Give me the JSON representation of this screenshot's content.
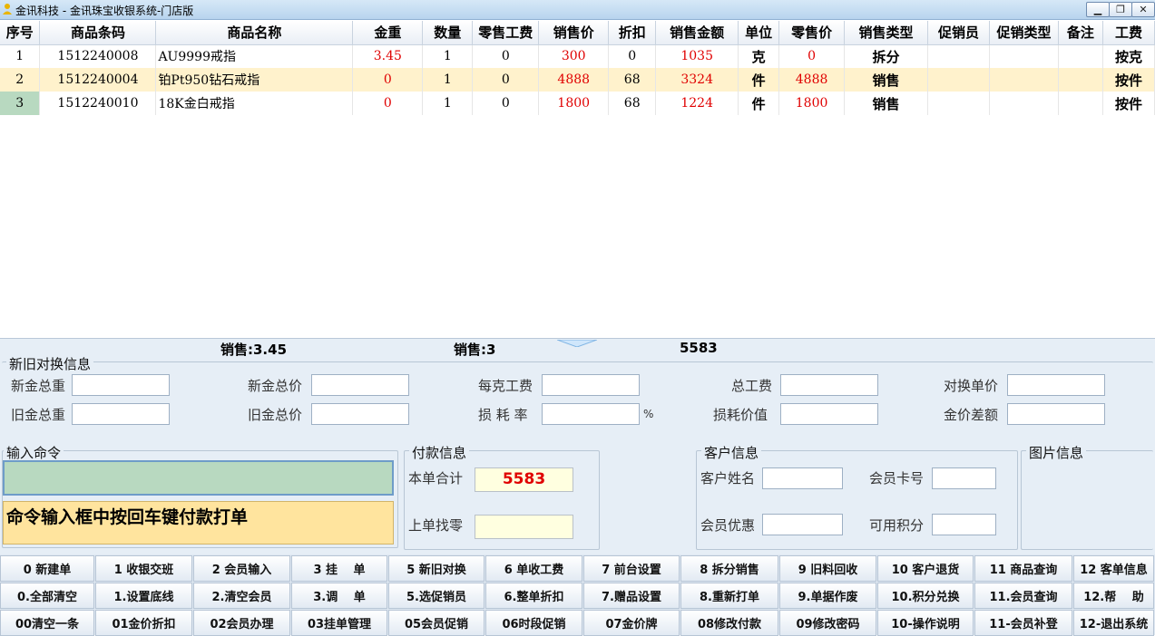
{
  "window": {
    "title": "金讯科技 - 金讯珠宝收银系统-门店版"
  },
  "grid": {
    "columns": [
      "序号",
      "商品条码",
      "商品名称",
      "金重",
      "数量",
      "零售工费",
      "销售价",
      "折扣",
      "销售金额",
      "单位",
      "零售价",
      "销售类型",
      "促销员",
      "促销类型",
      "备注",
      "工费"
    ],
    "rows": [
      [
        "1",
        "1512240008",
        "AU9999戒指",
        "3.45",
        "1",
        "0",
        "300",
        "0",
        "1035",
        "克",
        "0",
        "拆分",
        "",
        "",
        "",
        "按克"
      ],
      [
        "2",
        "1512240004",
        "铂Pt950钻石戒指",
        "0",
        "1",
        "0",
        "4888",
        "68",
        "3324",
        "件",
        "4888",
        "销售",
        "",
        "",
        "",
        "按件"
      ],
      [
        "3",
        "1512240010",
        "18K金白戒指",
        "0",
        "1",
        "0",
        "1800",
        "68",
        "1224",
        "件",
        "1800",
        "销售",
        "",
        "",
        "",
        "按件"
      ]
    ]
  },
  "summary": {
    "weight": "销售:3.45",
    "count": "销售:3",
    "amount": "5583"
  },
  "exchange": {
    "title": "新旧对换信息",
    "labels": [
      "新金总重",
      "新金总价",
      "每克工费",
      "总工费",
      "对换单价",
      "旧金总重",
      "旧金总价",
      "损 耗 率",
      "损耗价值",
      "金价差额"
    ],
    "percent": "%"
  },
  "command": {
    "title": "输入命令",
    "value": "",
    "hint": "命令输入框中按回车键付款打单"
  },
  "payment": {
    "title": "付款信息",
    "total_label": "本单合计",
    "total": "5583",
    "change_label": "上单找零"
  },
  "customer": {
    "title": "客户信息",
    "labels": [
      "客户姓名",
      "会员卡号",
      "会员优惠",
      "可用积分"
    ]
  },
  "picture": {
    "title": "图片信息"
  },
  "fkeys": [
    [
      "0 新建单",
      "1 收银交班",
      "2 会员输入",
      "3 挂　 单",
      "5 新旧对换",
      "6 单收工费",
      "7 前台设置",
      "8 拆分销售",
      "9 旧料回收",
      "10 客户退货",
      "11 商品查询",
      "12 客单信息"
    ],
    [
      "0.全部清空",
      "1.设置底线",
      "2.清空会员",
      "3.调　 单",
      "5.选促销员",
      "6.整单折扣",
      "7.赠品设置",
      "8.重新打单",
      "9.单据作废",
      "10.积分兑换",
      "11.会员查询",
      "12.帮　 助"
    ],
    [
      "00清空一条",
      "01金价折扣",
      "02会员办理",
      "03挂单管理",
      "05会员促销",
      "06时段促销",
      "07金价牌",
      "08修改付款",
      "09修改密码",
      "10-操作说明",
      "11-会员补登",
      "12-退出系统"
    ]
  ],
  "colors": {
    "red": "#e00000",
    "alt_row": "#fff2cc",
    "selected": "#b8d9c0",
    "hint": "#ffe49e"
  }
}
